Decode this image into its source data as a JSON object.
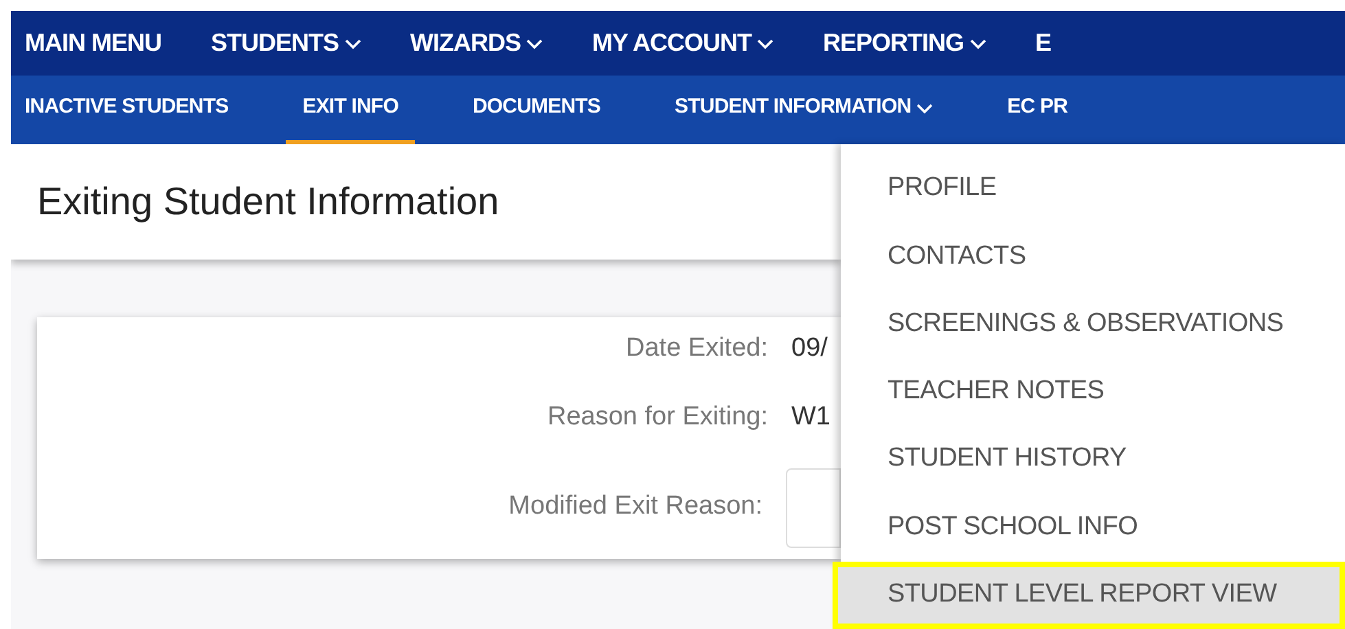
{
  "main_menu": [
    {
      "label": "MAIN MENU",
      "caret": false
    },
    {
      "label": "STUDENTS",
      "caret": true
    },
    {
      "label": "WIZARDS",
      "caret": true
    },
    {
      "label": "MY ACCOUNT",
      "caret": true
    },
    {
      "label": "REPORTING",
      "caret": true
    },
    {
      "label": "E",
      "caret": false
    }
  ],
  "sub_menu": [
    {
      "label": "INACTIVE STUDENTS",
      "selected": false,
      "caret": false
    },
    {
      "label": "EXIT INFO",
      "selected": true,
      "caret": false
    },
    {
      "label": "DOCUMENTS",
      "selected": false,
      "caret": false
    },
    {
      "label": "STUDENT INFORMATION",
      "selected": false,
      "caret": true
    },
    {
      "label": "EC PR",
      "selected": false,
      "caret": false
    }
  ],
  "page_title": "Exiting Student Information",
  "fields": [
    {
      "kind": "text",
      "label": "Date Exited:",
      "value": "09/"
    },
    {
      "kind": "text",
      "label": "Reason for Exiting:",
      "value": "W1"
    },
    {
      "kind": "input",
      "label": "Modified Exit Reason:"
    }
  ],
  "dropdown": [
    {
      "label": "PROFILE",
      "selected": false
    },
    {
      "label": "CONTACTS",
      "selected": false
    },
    {
      "label": "SCREENINGS & OBSERVATIONS",
      "selected": false
    },
    {
      "label": "TEACHER NOTES",
      "selected": false
    },
    {
      "label": "STUDENT HISTORY",
      "selected": false
    },
    {
      "label": "POST SCHOOL INFO",
      "selected": false
    },
    {
      "label": "STUDENT LEVEL REPORT VIEW",
      "selected": true
    }
  ]
}
